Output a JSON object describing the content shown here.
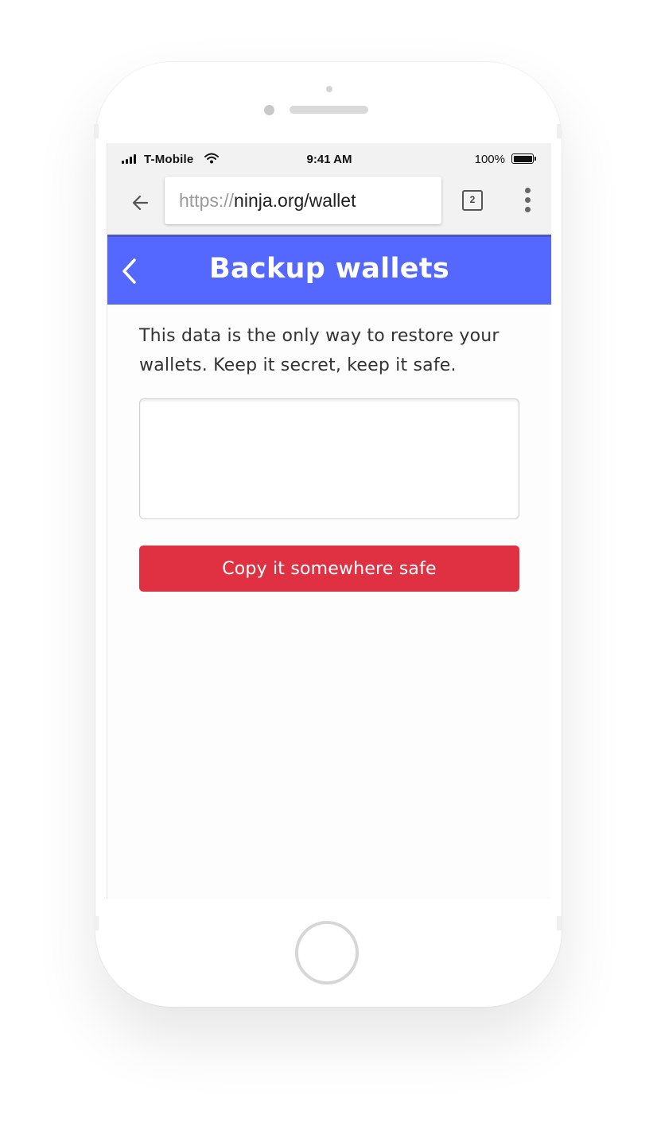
{
  "status_bar": {
    "carrier": "T-Mobile",
    "time": "9:41 AM",
    "battery_percent": "100%"
  },
  "browser": {
    "url_scheme": "https://",
    "url_host": "ninja.org/wallet",
    "tab_count": "2",
    "icons": {
      "back": "arrow-left-icon",
      "menu": "more-vertical-icon"
    }
  },
  "header": {
    "title": "Backup wallets",
    "back_icon": "chevron-left-icon",
    "background": "#5468ff"
  },
  "main": {
    "description": "This data is the only way to restore your wallets. Keep it secret, keep it safe.",
    "backup_field_value": "",
    "copy_button_label": "Copy it somewhere safe",
    "copy_button_color": "#e03142"
  }
}
